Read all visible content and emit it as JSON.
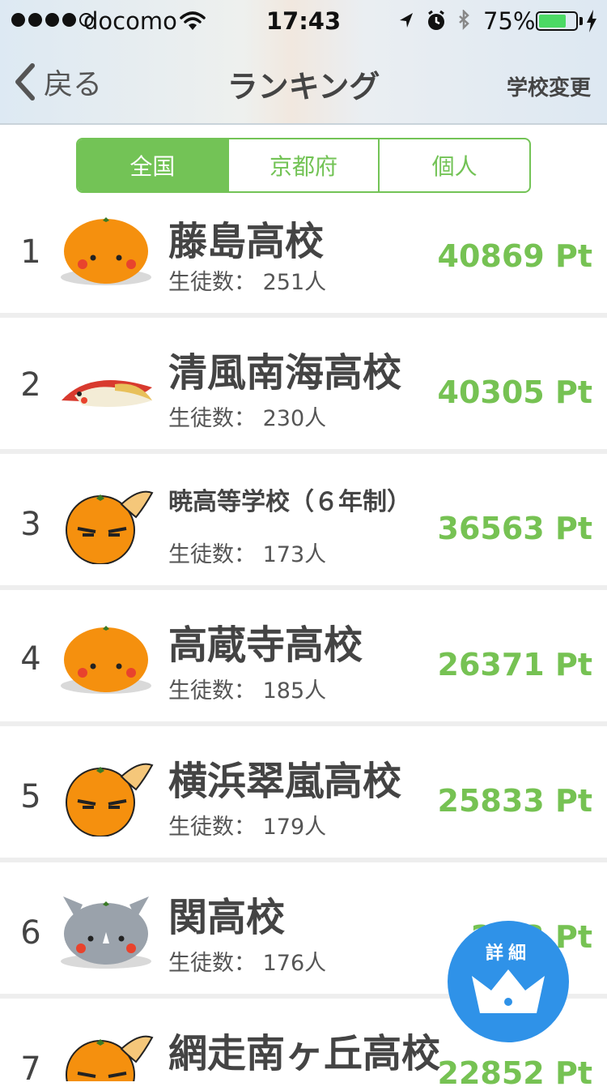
{
  "status_bar": {
    "carrier": "docomo",
    "time": "17:43",
    "battery_percent": "75%",
    "battery_level": 0.75
  },
  "nav": {
    "back_label": "戻る",
    "title": "ランキング",
    "right_action": "学校変更"
  },
  "tabs": [
    {
      "label": "全国",
      "active": true
    },
    {
      "label": "京都府",
      "active": false
    },
    {
      "label": "個人",
      "active": false
    }
  ],
  "rankings": [
    {
      "rank": "1",
      "school": "藤島高校",
      "students": "生徒数： 251人",
      "points": "40869 Pt",
      "mascot": "orange-mascot-icon"
    },
    {
      "rank": "2",
      "school": "清風南海高校",
      "students": "生徒数： 230人",
      "points": "40305 Pt",
      "mascot": "bird-mascot-icon"
    },
    {
      "rank": "3",
      "school": "暁高等学校（６年制）",
      "students": "生徒数： 173人",
      "points": "36563 Pt",
      "mascot": "fox-orange-mascot-icon"
    },
    {
      "rank": "4",
      "school": "高蔵寺高校",
      "students": "生徒数： 185人",
      "points": "26371 Pt",
      "mascot": "orange-mascot-icon"
    },
    {
      "rank": "5",
      "school": "横浜翠嵐高校",
      "students": "生徒数： 179人",
      "points": "25833 Pt",
      "mascot": "fox-orange-mascot-icon"
    },
    {
      "rank": "6",
      "school": "関高校",
      "students": "生徒数： 176人",
      "points": "2…3 Pt",
      "mascot": "rhino-mascot-icon"
    },
    {
      "rank": "7",
      "school": "網走南ヶ丘高校",
      "students": "",
      "points": "22852 Pt",
      "mascot": "fox-orange-mascot-icon"
    }
  ],
  "detail_button": {
    "label": "詳細",
    "icon": "crown-icon"
  },
  "colors": {
    "accent_green": "#73c356",
    "points_green": "#76c253",
    "fab_blue": "#2f92e8"
  }
}
